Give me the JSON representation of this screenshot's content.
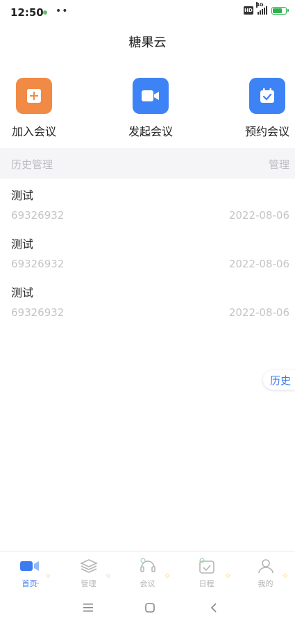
{
  "status": {
    "time": "12:50",
    "more": "••",
    "hd": "HD",
    "network": "4G"
  },
  "header": {
    "title": "糖果云"
  },
  "actions": [
    {
      "label": "加入会议",
      "icon": "plus-square-icon",
      "color": "#f08a45"
    },
    {
      "label": "发起会议",
      "icon": "video-camera-icon",
      "color": "#3d83f5"
    },
    {
      "label": "预约会议",
      "icon": "calendar-check-icon",
      "color": "#3d83f5"
    }
  ],
  "history": {
    "title": "历史管理",
    "manage_label": "管理"
  },
  "records": [
    {
      "name": "测试",
      "id": "69326932",
      "date": "2022-08-06"
    },
    {
      "name": "测试",
      "id": "69326932",
      "date": "2022-08-06"
    },
    {
      "name": "测试",
      "id": "69326932",
      "date": "2022-08-06"
    }
  ],
  "float_button": {
    "label": "历史"
  },
  "tabs": [
    {
      "label": "首页",
      "icon": "video-camera-icon",
      "active": true
    },
    {
      "label": "管理",
      "icon": "layers-icon",
      "active": false
    },
    {
      "label": "会议",
      "icon": "headset-icon",
      "active": false
    },
    {
      "label": "日程",
      "icon": "calendar-icon",
      "active": false
    },
    {
      "label": "我的",
      "icon": "user-icon",
      "active": false
    }
  ],
  "colors": {
    "accent": "#3d7bf0",
    "orange": "#f08a45",
    "muted": "#c4c4c8",
    "battery": "#2cb34a"
  }
}
